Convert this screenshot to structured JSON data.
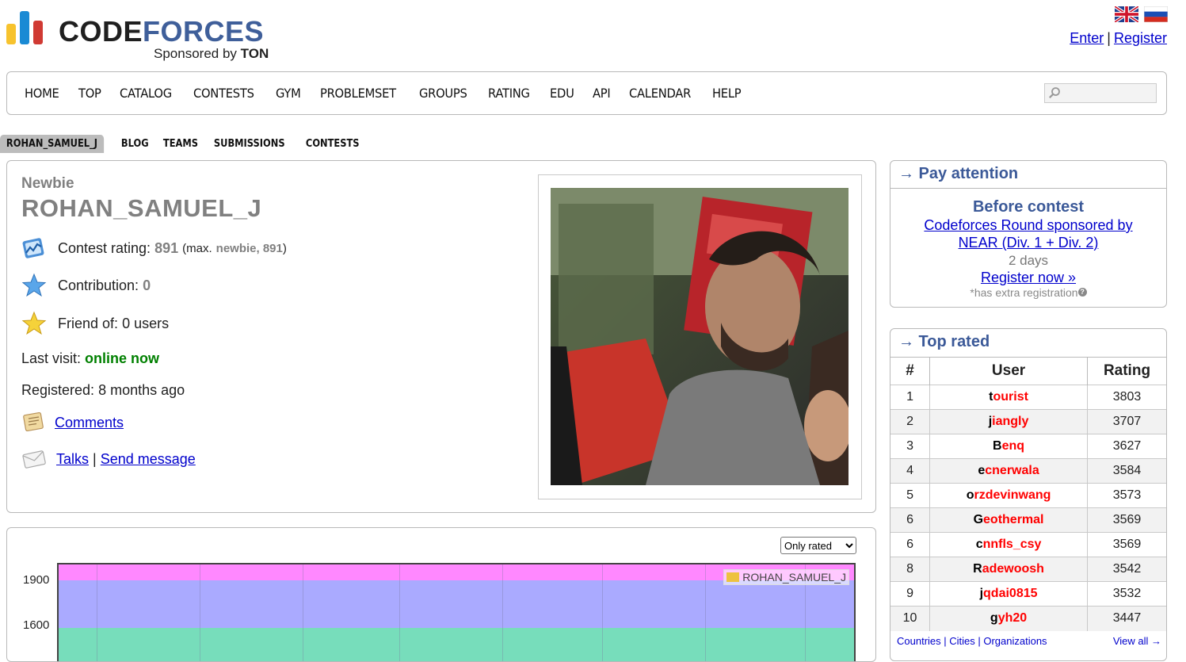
{
  "header": {
    "logo_code": "CODE",
    "logo_forces": "FORCES",
    "sponsor_prefix": "Sponsored by",
    "sponsor_name": "TON",
    "enter": "Enter",
    "register": "Register",
    "separator": "|"
  },
  "nav": {
    "items": [
      "HOME",
      "TOP",
      "CATALOG",
      "CONTESTS",
      "GYM",
      "PROBLEMSET",
      "GROUPS",
      "RATING",
      "EDU",
      "API",
      "CALENDAR",
      "HELP"
    ]
  },
  "subnav": {
    "items": [
      "ROHAN_SAMUEL_J",
      "BLOG",
      "TEAMS",
      "SUBMISSIONS",
      "CONTESTS"
    ]
  },
  "profile": {
    "rank": "Newbie",
    "handle": "ROHAN_SAMUEL_J",
    "rating_label": "Contest rating:",
    "rating_value": "891",
    "max_open": "(max.",
    "max_rank": "newbie, 891",
    "max_close": ")",
    "contribution_label": "Contribution:",
    "contribution_value": "0",
    "friend_label": "Friend of:",
    "friend_value": "0 users",
    "last_visit_label": "Last visit:",
    "last_visit_value": "online now",
    "registered_label": "Registered:",
    "registered_value": "8 months ago",
    "comments": "Comments",
    "talks": "Talks",
    "talks_sep": "|",
    "send_message": "Send message"
  },
  "graph": {
    "filter_option": "Only rated",
    "legend": "ROHAN_SAMUEL_J",
    "ticks": [
      "1900",
      "1600"
    ]
  },
  "pay_attention": {
    "title": "→ Pay attention",
    "heading": "Before contest",
    "contest_line1": "Codeforces Round sponsored by",
    "contest_line2": "NEAR (Div. 1 + Div. 2)",
    "days": "2 days",
    "register_now": "Register now »",
    "note": "*has extra registration",
    "q": "?"
  },
  "top_rated": {
    "title": "→ Top rated",
    "headers": [
      "#",
      "User",
      "Rating"
    ],
    "rows": [
      {
        "rank": "1",
        "first": "t",
        "rest": "ourist",
        "rating": "3803"
      },
      {
        "rank": "2",
        "first": "j",
        "rest": "iangly",
        "rating": "3707"
      },
      {
        "rank": "3",
        "first": "B",
        "rest": "enq",
        "rating": "3627"
      },
      {
        "rank": "4",
        "first": "e",
        "rest": "cnerwala",
        "rating": "3584"
      },
      {
        "rank": "5",
        "first": "o",
        "rest": "rzdevinwang",
        "rating": "3573"
      },
      {
        "rank": "6",
        "first": "G",
        "rest": "eothermal",
        "rating": "3569"
      },
      {
        "rank": "6",
        "first": "c",
        "rest": "nnfls_csy",
        "rating": "3569"
      },
      {
        "rank": "8",
        "first": "R",
        "rest": "adewoosh",
        "rating": "3542"
      },
      {
        "rank": "9",
        "first": "j",
        "rest": "qdai0815",
        "rating": "3532"
      },
      {
        "rank": "10",
        "first": "g",
        "rest": "yh20",
        "rating": "3447"
      }
    ],
    "footer_links": "Countries | Cities | Organizations",
    "view_all": "View all →"
  },
  "colors": {
    "accent": "#3b5998",
    "legendary": "#ff0000",
    "newbie": "#808080",
    "online": "#008000"
  }
}
